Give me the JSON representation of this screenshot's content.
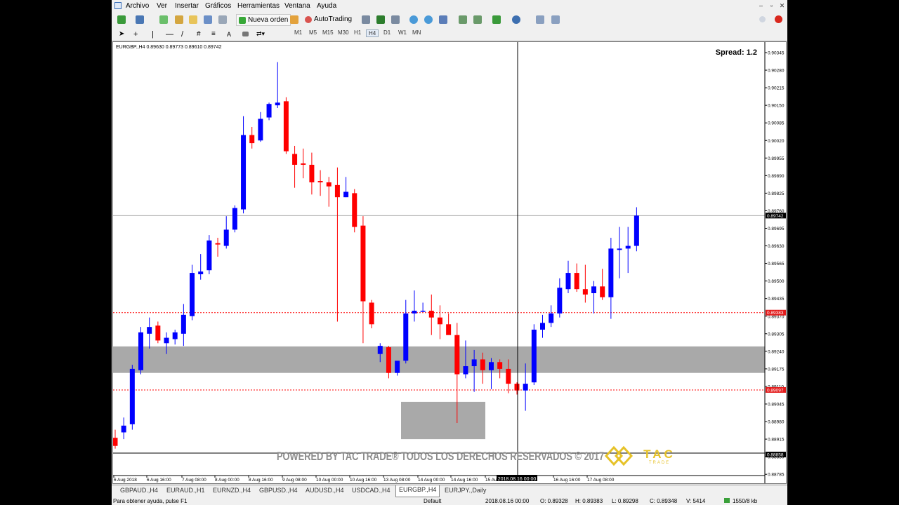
{
  "menu": {
    "items": [
      "Archivo",
      "Ver",
      "Insertar",
      "Gráficos",
      "Herramientas",
      "Ventana",
      "Ayuda"
    ]
  },
  "toolbar": {
    "new_order_label": "Nueva orden",
    "autotrading_label": "AutoTrading",
    "timeframes": [
      "M1",
      "M5",
      "M15",
      "M30",
      "H1",
      "H4",
      "D1",
      "W1",
      "MN"
    ],
    "active_timeframe": "H4"
  },
  "chart": {
    "info": "EURGBP.,H4  0.89630 0.89773 0.89610 0.89742",
    "spread_label": "Spread: 1.2",
    "watermark": "POWERED BY TAC TRADE® TODOS LOS DERECHOS RESERVADOS © 2017",
    "logo_text": "TAC",
    "logo_sub": "TRADE",
    "crosshair_time": "2018.08.16 00:00",
    "price_markers": {
      "current": "0.89742",
      "level_red_upper": "0.89383",
      "level_red_lower": "0.89097",
      "bottom": "0.88858"
    },
    "colors": {
      "bull": "#0000ff",
      "bear": "#ff0000",
      "zone": "#a9a9a9",
      "level": "#ff0000"
    }
  },
  "chart_data": {
    "type": "candlestick",
    "symbol": "EURGBP.",
    "timeframe": "H4",
    "y_ticks": [
      "0.90345",
      "0.90280",
      "0.90215",
      "0.90150",
      "0.90085",
      "0.90020",
      "0.89955",
      "0.89890",
      "0.89825",
      "0.89760",
      "0.89695",
      "0.89630",
      "0.89565",
      "0.89500",
      "0.89435",
      "0.89370",
      "0.89305",
      "0.89240",
      "0.89175",
      "0.89110",
      "0.89045",
      "0.88980",
      "0.88915",
      "0.88850",
      "0.88785"
    ],
    "x_ticks": [
      "6 Aug 2018",
      "6 Aug 16:00",
      "7 Aug 08:00",
      "8 Aug 00:00",
      "8 Aug 16:00",
      "9 Aug 08:00",
      "10 Aug 00:00",
      "10 Aug 16:00",
      "13 Aug 08:00",
      "14 Aug 00:00",
      "14 Aug 16:00",
      "15 Au",
      "16 Aug 00:00",
      "16 Aug 16:00",
      "17 Aug 08:00"
    ],
    "zones": [
      {
        "name": "support-zone",
        "from": 0.8916,
        "to": 0.89258
      },
      {
        "name": "demand-box",
        "from": 0.88915,
        "to": 0.89053
      }
    ],
    "levels": [
      0.89383,
      0.89097,
      0.89742
    ],
    "candles": [
      [
        0.8892,
        0.8895,
        0.8888,
        0.8889
      ],
      [
        0.8894,
        0.88995,
        0.88915,
        0.88965
      ],
      [
        0.8897,
        0.8919,
        0.8895,
        0.89175
      ],
      [
        0.8917,
        0.8933,
        0.89155,
        0.8931
      ],
      [
        0.89305,
        0.89365,
        0.8925,
        0.8933
      ],
      [
        0.89335,
        0.8935,
        0.8927,
        0.8928
      ],
      [
        0.8927,
        0.8931,
        0.8923,
        0.8929
      ],
      [
        0.89285,
        0.8932,
        0.89265,
        0.8931
      ],
      [
        0.89305,
        0.89415,
        0.8926,
        0.89375
      ],
      [
        0.8937,
        0.8956,
        0.89355,
        0.8953
      ],
      [
        0.89525,
        0.896,
        0.89505,
        0.89535
      ],
      [
        0.8954,
        0.8967,
        0.89525,
        0.8965
      ],
      [
        0.8964,
        0.8966,
        0.8959,
        0.89635
      ],
      [
        0.8963,
        0.8974,
        0.8962,
        0.8969
      ],
      [
        0.8969,
        0.8978,
        0.8968,
        0.8977
      ],
      [
        0.89765,
        0.9011,
        0.8975,
        0.9004
      ],
      [
        0.9004,
        0.9007,
        0.8999,
        0.9001
      ],
      [
        0.9002,
        0.90125,
        0.90015,
        0.901
      ],
      [
        0.90105,
        0.9016,
        0.90095,
        0.90155
      ],
      [
        0.9015,
        0.9031,
        0.9014,
        0.9016
      ],
      [
        0.90165,
        0.9018,
        0.8997,
        0.8998
      ],
      [
        0.8997,
        0.9,
        0.89845,
        0.8993
      ],
      [
        0.89935,
        0.8999,
        0.8988,
        0.8993
      ],
      [
        0.8993,
        0.89975,
        0.8982,
        0.89865
      ],
      [
        0.8987,
        0.8991,
        0.89815,
        0.89865
      ],
      [
        0.89865,
        0.89885,
        0.89775,
        0.8985
      ],
      [
        0.89855,
        0.8992,
        0.8935,
        0.8981
      ],
      [
        0.8981,
        0.89885,
        0.8981,
        0.8983
      ],
      [
        0.89825,
        0.8984,
        0.8968,
        0.897
      ],
      [
        0.89705,
        0.8974,
        0.8927,
        0.89425
      ],
      [
        0.8942,
        0.8943,
        0.89325,
        0.8934
      ],
      [
        0.8923,
        0.8927,
        0.892,
        0.8926
      ],
      [
        0.89255,
        0.8926,
        0.8914,
        0.8916
      ],
      [
        0.8916,
        0.89175,
        0.8915,
        0.89205
      ],
      [
        0.89205,
        0.8943,
        0.89195,
        0.8938
      ],
      [
        0.8938,
        0.89465,
        0.8935,
        0.8939
      ],
      [
        0.8939,
        0.8942,
        0.89385,
        0.8939
      ],
      [
        0.8939,
        0.8945,
        0.893,
        0.89365
      ],
      [
        0.89365,
        0.8941,
        0.89285,
        0.8934
      ],
      [
        0.8934,
        0.8938,
        0.8931,
        0.893
      ],
      [
        0.893,
        0.89345,
        0.88975,
        0.89155
      ],
      [
        0.89155,
        0.8928,
        0.8914,
        0.89185
      ],
      [
        0.89185,
        0.89245,
        0.8909,
        0.8921
      ],
      [
        0.8921,
        0.89235,
        0.8912,
        0.8917
      ],
      [
        0.8917,
        0.89215,
        0.891,
        0.892
      ],
      [
        0.892,
        0.8921,
        0.8914,
        0.89175
      ],
      [
        0.89175,
        0.8921,
        0.89085,
        0.8912
      ],
      [
        0.8912,
        0.89125,
        0.8908,
        0.89095
      ],
      [
        0.89095,
        0.89195,
        0.8902,
        0.8912
      ],
      [
        0.89125,
        0.8934,
        0.89115,
        0.8932
      ],
      [
        0.8932,
        0.89375,
        0.8929,
        0.89345
      ],
      [
        0.89345,
        0.8941,
        0.8933,
        0.8938
      ],
      [
        0.8938,
        0.8951,
        0.89365,
        0.89475
      ],
      [
        0.8947,
        0.89575,
        0.89455,
        0.8953
      ],
      [
        0.8953,
        0.89565,
        0.8946,
        0.8947
      ],
      [
        0.8947,
        0.8956,
        0.8942,
        0.8945
      ],
      [
        0.89455,
        0.895,
        0.8938,
        0.8948
      ],
      [
        0.8948,
        0.89545,
        0.8943,
        0.8944
      ],
      [
        0.8944,
        0.8966,
        0.8936,
        0.8962
      ],
      [
        0.89615,
        0.897,
        0.8951,
        0.8962
      ],
      [
        0.8962,
        0.897,
        0.8953,
        0.8963
      ],
      [
        0.8963,
        0.89773,
        0.8961,
        0.89742
      ]
    ]
  },
  "tabs": [
    "GBPAUD.,H4",
    "EURAUD.,H1",
    "EURNZD.,H4",
    "GBPUSD.,H4",
    "AUDUSD.,H4",
    "USDCAD.,H4",
    "EURGBP.,H4",
    "EURJPY.,Daily"
  ],
  "active_tab": "EURGBP.,H4",
  "status": {
    "help": "Para obtener ayuda, pulse F1",
    "profile": "Default",
    "time": "2018.08.16 00:00",
    "open": "O: 0.89328",
    "high": "H: 0.89383",
    "low": "L: 0.89298",
    "close": "C: 0.89348",
    "volume": "V: 5414",
    "traffic": "1550/8 kb"
  }
}
